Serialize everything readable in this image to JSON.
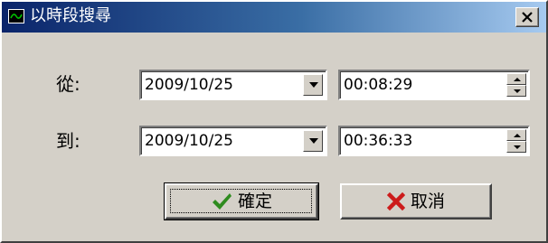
{
  "window": {
    "title": "以時段搜尋",
    "icon": "clock-chart-icon",
    "close_icon": "close-icon"
  },
  "from_row": {
    "label": "從:",
    "date_value": "2009/10/25",
    "time_value": "00:08:29"
  },
  "to_row": {
    "label": "到:",
    "date_value": "2009/10/25",
    "time_value": "00:36:33"
  },
  "buttons": {
    "ok_label": "確定",
    "ok_icon": "checkmark-icon",
    "cancel_label": "取消",
    "cancel_icon": "red-x-icon"
  },
  "colors": {
    "titlebar_start": "#0a246a",
    "titlebar_end": "#a6caf0",
    "dialog_face": "#d4d0c8",
    "ok_check": "#2e8b1e",
    "cancel_x": "#cc1b1b"
  }
}
